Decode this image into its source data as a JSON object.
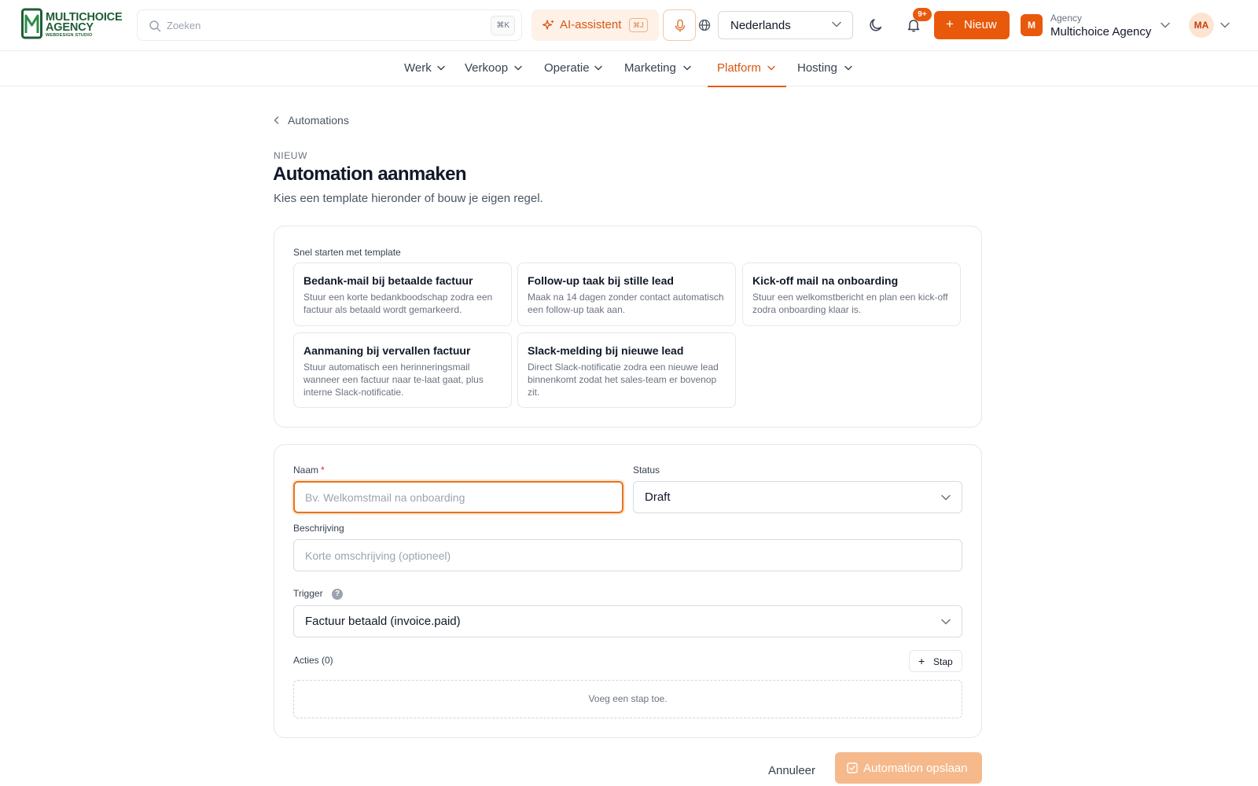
{
  "brand": {
    "name_line1": "MULTICHOICE",
    "name_line2": "AGENCY",
    "tagline": "WEBDESIGN STUDIO",
    "color": "#1f5d35"
  },
  "header": {
    "search_placeholder": "Zoeken",
    "search_shortcut": "⌘K",
    "ai_label": "AI-assistent",
    "ai_shortcut": "⌘J",
    "language": "Nederlands",
    "notifications_badge": "9+",
    "new_label": "Nieuw",
    "agency_kicker": "Agency",
    "agency_name": "Multichoice Agency",
    "agency_initial": "M",
    "user_initials": "MA",
    "accent_color": "#e8590c"
  },
  "nav": {
    "items": [
      {
        "label": "Werk"
      },
      {
        "label": "Verkoop"
      },
      {
        "label": "Operatie"
      },
      {
        "label": "Marketing"
      },
      {
        "label": "Platform",
        "active": true
      },
      {
        "label": "Hosting"
      }
    ]
  },
  "page": {
    "back_label": "Automations",
    "eyebrow": "NIEUW",
    "title": "Automation aanmaken",
    "subtitle": "Kies een template hieronder of bouw je eigen regel."
  },
  "templates": {
    "section_title": "Snel starten met template",
    "items": [
      {
        "title": "Bedank-mail bij betaalde factuur",
        "description": "Stuur een korte bedankboodschap zodra een factuur als betaald wordt gemarkeerd."
      },
      {
        "title": "Follow-up taak bij stille lead",
        "description": "Maak na 14 dagen zonder contact automatisch een follow-up taak aan."
      },
      {
        "title": "Kick-off mail na onboarding",
        "description": "Stuur een welkomstbericht en plan een kick-off zodra onboarding klaar is."
      },
      {
        "title": "Aanmaning bij vervallen factuur",
        "description": "Stuur automatisch een herinneringsmail wanneer een factuur naar te-laat gaat, plus interne Slack-notificatie."
      },
      {
        "title": "Slack-melding bij nieuwe lead",
        "description": "Direct Slack-notificatie zodra een nieuwe lead binnenkomt zodat het sales-team er bovenop zit."
      }
    ]
  },
  "form": {
    "name_label": "Naam",
    "name_required_mark": "*",
    "name_placeholder": "Bv. Welkomstmail na onboarding",
    "name_value": "",
    "status_label": "Status",
    "status_value": "Draft",
    "description_label": "Beschrijving",
    "description_placeholder": "Korte omschrijving (optioneel)",
    "description_value": "",
    "trigger_label": "Trigger",
    "trigger_help": "?",
    "trigger_value": "Factuur betaald (invoice.paid)",
    "actions_label": "Acties (0)",
    "add_step_label": "Stap",
    "empty_actions": "Voeg een stap toe."
  },
  "footer": {
    "cancel_label": "Annuleer",
    "save_label": "Automation opslaan",
    "save_color": "#f6b98c"
  }
}
